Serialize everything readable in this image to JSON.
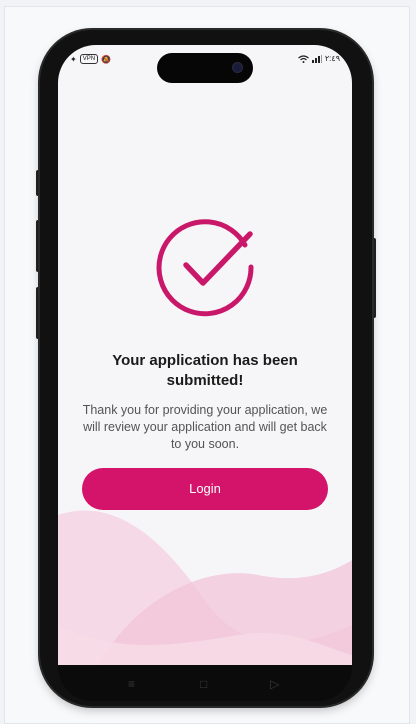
{
  "status_bar": {
    "left_badge": "VPN",
    "time": "٢:٤٩"
  },
  "confirmation": {
    "title": "Your application has been submitted!",
    "message": "Thank you for providing your application, we will review your application and will get back to you soon.",
    "login_label": "Login"
  },
  "nav_bar": {
    "menu_icon": "≡",
    "home_icon": "□",
    "back_icon": "▷"
  },
  "colors": {
    "accent": "#d3146a",
    "wave_light": "#f4cfe0"
  }
}
